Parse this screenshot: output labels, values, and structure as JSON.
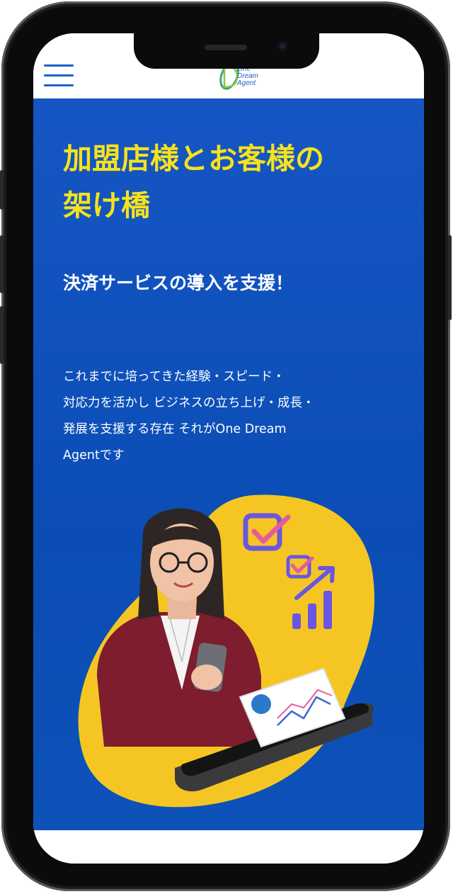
{
  "header": {
    "logo_lines": [
      "One",
      "Dream",
      "Agent"
    ]
  },
  "hero": {
    "title_line1": "加盟店様とお客様の",
    "title_line2": "架け橋",
    "subtitle": "決済サービスの導入を支援！",
    "desc_lines": [
      "これまでに培ってきた経験・スピード・",
      "対応力を活かし ビジネスの立ち上げ・成長・",
      "発展を支援する存在 それがOne Dream",
      "Agentです"
    ]
  },
  "colors": {
    "hero_bg": "#1556c4",
    "title": "#f6e21c",
    "accent_blob": "#f5c623",
    "nav_icon": "#1e63c8"
  }
}
